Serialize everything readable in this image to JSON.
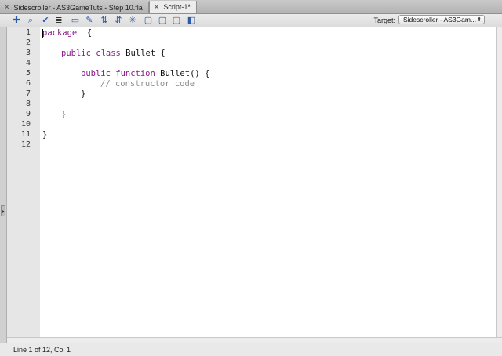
{
  "tabs": [
    {
      "label": "Sidescroller - AS3GameTuts - Step 10.fla",
      "active": false
    },
    {
      "label": "Script-1*",
      "active": true
    }
  ],
  "toolbar": {
    "icons": [
      "add-statement-icon",
      "find-icon",
      "check-syntax-icon",
      "auto-format-icon",
      "code-hint-icon",
      "debug-options-icon",
      "collapse-between-braces-icon",
      "collapse-selection-icon",
      "expand-all-icon",
      "apply-block-comment-icon",
      "apply-line-comment-icon",
      "remove-comment-icon",
      "show-hide-toolbox-icon"
    ],
    "target_label": "Target:",
    "target_value": "Sidescroller - AS3Gam..."
  },
  "line_numbers": [
    "1",
    "2",
    "3",
    "4",
    "5",
    "6",
    "7",
    "8",
    "9",
    "10",
    "11",
    "12"
  ],
  "code": {
    "l1_kw": "package",
    "l1_rest": "  {",
    "l3_kw": "public class",
    "l3_rest": " Bullet {",
    "l5_kw": "public function",
    "l5_rest": " Bullet() {",
    "l6_comment": "// constructor code",
    "l7": "}",
    "l9": "}",
    "l11": "}"
  },
  "status": {
    "position": "Line 1 of 12, Col 1"
  },
  "colors": {
    "keyword": "#8a1a8a",
    "comment": "#8c8c8c",
    "text": "#111111"
  }
}
